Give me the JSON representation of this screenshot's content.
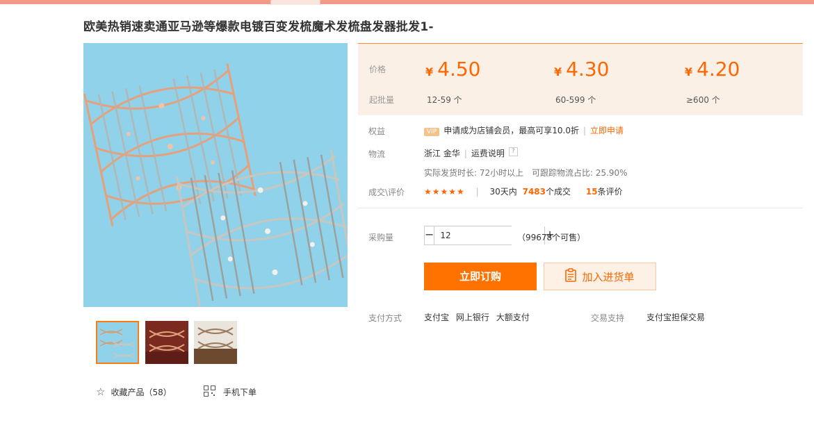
{
  "title": "欧美热销速卖通亚马逊等爆款电镀百变发梳魔术发梳盘发器批发1-",
  "price": {
    "label": "价格",
    "qty_label": "起批量",
    "currency": "¥",
    "tiers": [
      {
        "price": "4.50",
        "qty": "12-59 个"
      },
      {
        "price": "4.30",
        "qty": "60-599 个"
      },
      {
        "price": "4.20",
        "qty": "≥600 个"
      }
    ]
  },
  "benefit": {
    "label": "权益",
    "badge": "VIP",
    "text": "申请成为店铺会员，最高可享10.0折",
    "link": "立即申请"
  },
  "logistics": {
    "label": "物流",
    "origin": "浙江 金华",
    "fee_link": "运费说明",
    "help": "?",
    "ship_time": "实际发货时长: 72小时以上",
    "track_rate": "可跟踪物流占比: 25.90%"
  },
  "deal": {
    "label": "成交\\评价",
    "stars": "★★★★★",
    "days_prefix": "30天内",
    "count": "7483",
    "count_suffix": "个成交",
    "reviews": "15",
    "reviews_suffix": "条评价"
  },
  "purchase": {
    "label": "采购量",
    "minus": "−",
    "plus": "+",
    "quantity": "12",
    "available": "（99678个可售）"
  },
  "buttons": {
    "buy_now": "立即订购",
    "add_cart": "加入进货单"
  },
  "payment": {
    "label": "支付方式",
    "methods": [
      "支付宝",
      "网上银行",
      "大额支付"
    ]
  },
  "trade": {
    "label": "交易支持",
    "value": "支付宝担保交易"
  },
  "favorites": {
    "icon": "star-outline-icon",
    "label": "收藏产品（58）"
  },
  "mobile_order": {
    "icon": "qr-code-icon",
    "label": "手机下单"
  },
  "colors": {
    "accent": "#ff6600",
    "button": "#ff7200",
    "panel_bg": "#fbf0e6",
    "image_bg": "#8fd2ea"
  }
}
